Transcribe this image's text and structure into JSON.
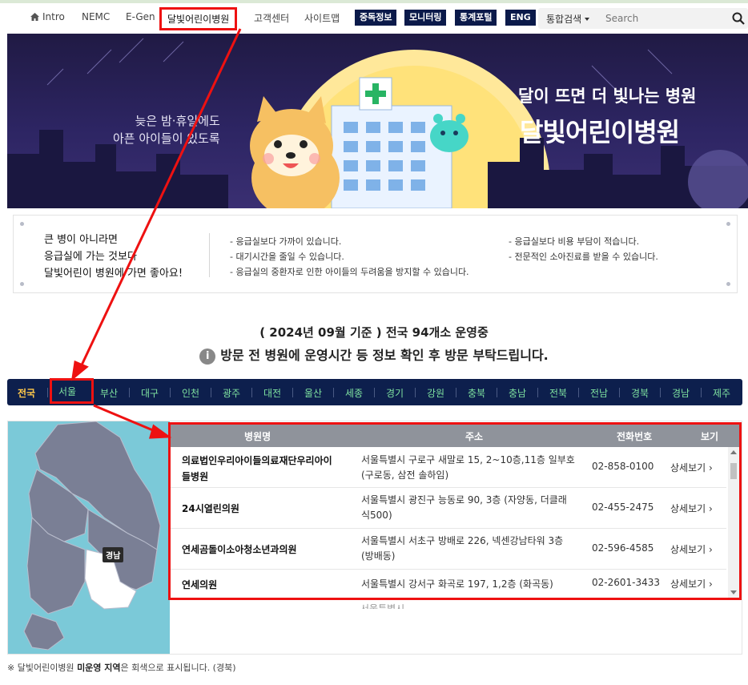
{
  "header": {
    "nav": [
      {
        "label": "Intro",
        "icon": "home-icon"
      },
      {
        "label": "NEMC"
      },
      {
        "label": "E-Gen"
      },
      {
        "label": "달빛어린이병원"
      },
      {
        "label": "고객센터"
      },
      {
        "label": "사이트맵"
      }
    ],
    "buttons": [
      "중독정보",
      "모니터링",
      "통계포털",
      "ENG"
    ],
    "search": {
      "scope": "통합검색",
      "placeholder": "Search"
    }
  },
  "banner": {
    "left_line1": "늦은 밤·휴일에도",
    "left_line2": "아픈 아이들이 있도록",
    "tagline": "달이 뜨면 더 빛나는 병원",
    "title": "달빛어린이병원"
  },
  "info": {
    "left": [
      "큰 병이 아니라면",
      "응급실에 가는 것보다",
      "달빛어린이 병원에 가면 좋아요!"
    ],
    "middle": [
      "- 응급실보다 가까이 있습니다.",
      "- 대기시간을 줄일 수 있습니다.",
      "- 응급실의 중환자로 인한 아이들의 두려움을 방지할 수 있습니다."
    ],
    "right": [
      "- 응급실보다 비용 부담이 적습니다.",
      "- 전문적인 소아진료를 받을 수 있습니다."
    ]
  },
  "notice": {
    "line1": "( 2024년 09월 기준 ) 전국 94개소 운영중",
    "line2": "방문 전 병원에 운영시간 등 정보 확인 후 방문 부탁드립니다.",
    "icon_text": "i"
  },
  "regions": [
    "전국",
    "서울",
    "부산",
    "대구",
    "인천",
    "광주",
    "대전",
    "울산",
    "세종",
    "경기",
    "강원",
    "충북",
    "충남",
    "전북",
    "전남",
    "경북",
    "경남",
    "제주"
  ],
  "map": {
    "label": "경남"
  },
  "table": {
    "headers": [
      "병원명",
      "주소",
      "전화번호",
      "보기"
    ],
    "rows": [
      {
        "name": [
          "의료법인우리아이들의료재단우리아이",
          "들병원"
        ],
        "addr": [
          "서울특별시 구로구 새말로 15, 2~10층,11층 일부호",
          "(구로동, 삼전 솔하임)"
        ],
        "tel": "02-858-0100",
        "view": "상세보기 ›"
      },
      {
        "name": [
          "24시열린의원"
        ],
        "addr": [
          "서울특별시 광진구 능동로 90, 3층 (자양동, 더클래",
          "식500)"
        ],
        "tel": "02-455-2475",
        "view": "상세보기 ›"
      },
      {
        "name": [
          "연세곰돌이소아청소년과의원"
        ],
        "addr": [
          "서울특별시 서초구 방배로 226, 넥센강남타워 3층",
          "(방배동)"
        ],
        "tel": "02-596-4585",
        "view": "상세보기 ›"
      },
      {
        "name": [
          "연세의원"
        ],
        "addr": [
          "서울특별시 강서구 화곡로 197, 1,2층 (화곡동)"
        ],
        "tel": "02-2601-3433",
        "view": "상세보기 ›"
      }
    ],
    "below_fragment": "서울특별시 ..."
  },
  "footnote": {
    "prefix": "※ 달빛어린이병원 ",
    "bold": "미운영 지역",
    "suffix": "은 회색으로 표시됩니다. (경북)"
  },
  "colors": {
    "nav_dark": "#0d1f4d",
    "region_text": "#7fe2a0",
    "region_active": "#ffc84a",
    "highlight": "#ee1111"
  }
}
